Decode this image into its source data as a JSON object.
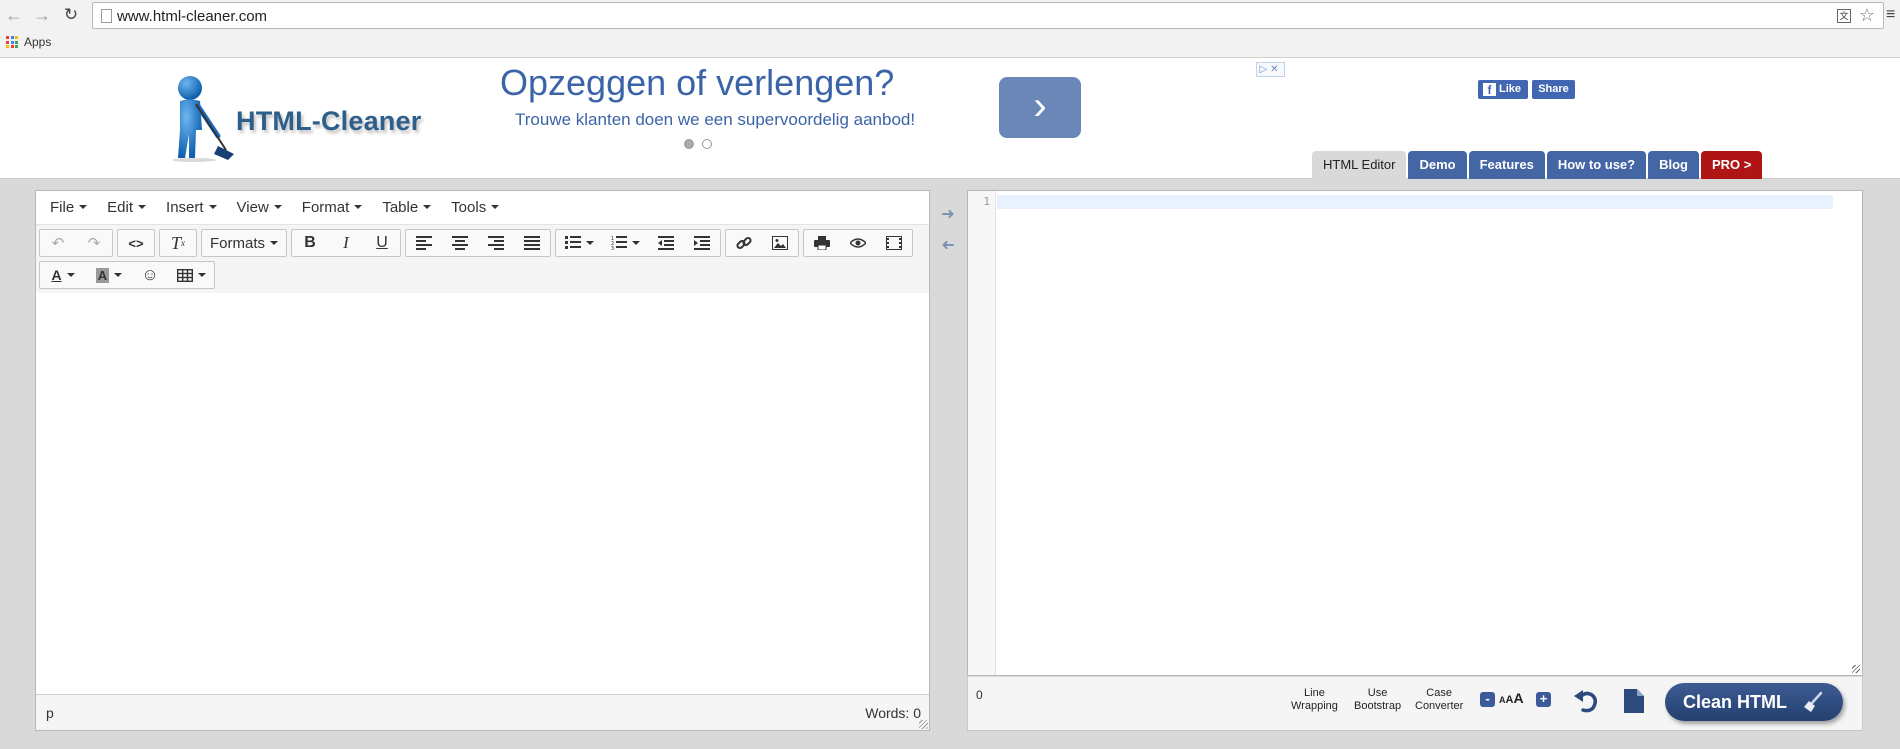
{
  "browser": {
    "url": "www.html-cleaner.com",
    "bookmarks": {
      "apps_label": "Apps"
    }
  },
  "header": {
    "brand": "HTML-Cleaner",
    "ad": {
      "headline": "Opzeggen of verlengen?",
      "subline": "Trouwe klanten doen we een supervoordelig aanbod!",
      "next_symbol": "›",
      "adchoices": "▷✕",
      "carousel_dots": 2,
      "carousel_active": 1
    },
    "social": {
      "like_label": "Like",
      "share_label": "Share"
    },
    "tabs": [
      {
        "label": "HTML Editor",
        "active": true
      },
      {
        "label": "Demo"
      },
      {
        "label": "Features"
      },
      {
        "label": "How to use?"
      },
      {
        "label": "Blog"
      },
      {
        "label": "PRO >"
      }
    ]
  },
  "editor": {
    "menus": [
      "File",
      "Edit",
      "Insert",
      "View",
      "Format",
      "Table",
      "Tools"
    ],
    "formats_label": "Formats",
    "status": {
      "path": "p",
      "words": "Words: 0"
    }
  },
  "code_editor": {
    "line_numbers": [
      "1"
    ],
    "char_count": "0",
    "options": {
      "line_wrapping": [
        "Line",
        "Wrapping"
      ],
      "use_bootstrap": [
        "Use",
        "Bootstrap"
      ],
      "case_converter": [
        "Case",
        "Converter"
      ]
    },
    "font_size": {
      "minus": "-",
      "plus": "+",
      "aa_small": "A",
      "aa_mid": "A",
      "aa_large": "A"
    },
    "clean_button_label": "Clean HTML"
  },
  "colors": {
    "nav_tab": "#4466a5",
    "pro_tab": "#b01515",
    "ad_text": "#3b64a8",
    "facebook": "#4267b2"
  }
}
